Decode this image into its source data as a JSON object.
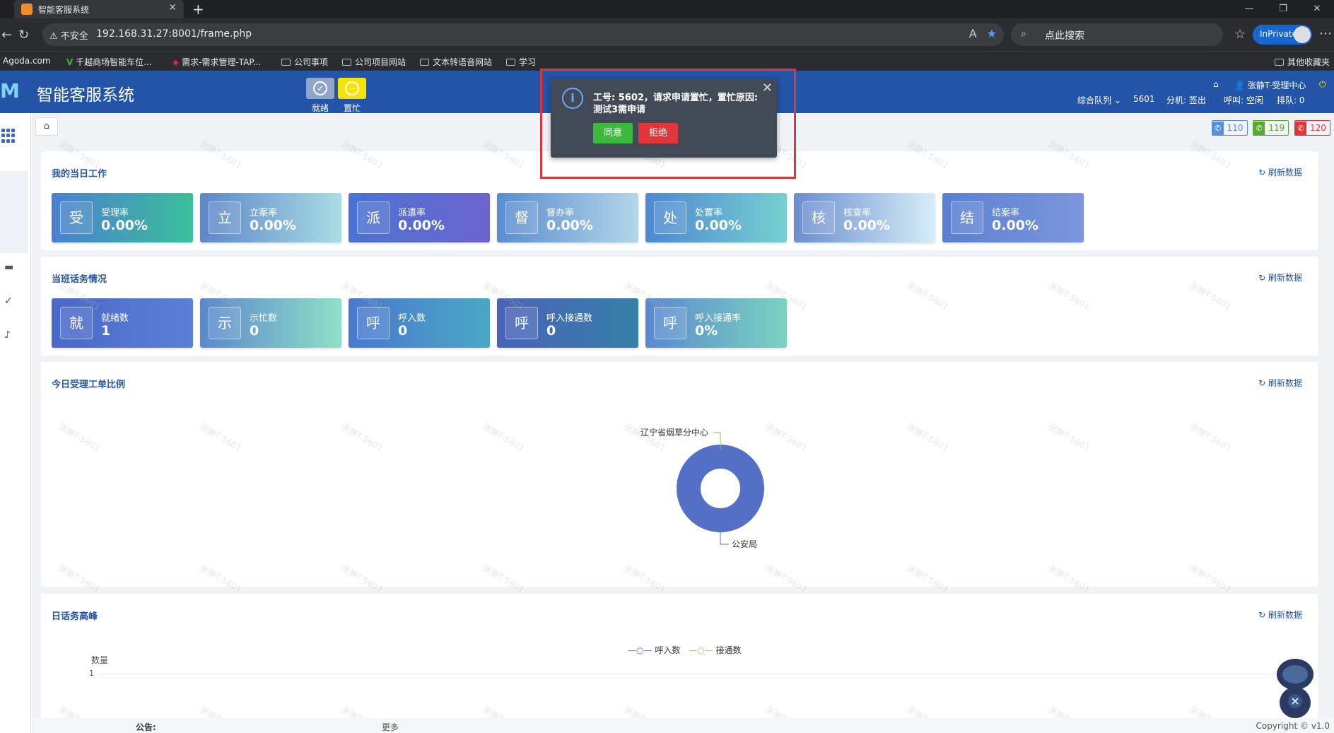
{
  "browser": {
    "tab_title": "智能客服系统",
    "new_tab": "+",
    "url_warning": "不安全",
    "url": "192.168.31.27:8001/frame.php",
    "search_placeholder": "点此搜索",
    "inprivate": "InPrivate",
    "bookmarks": [
      "Agoda.com",
      "千越商场智能车位...",
      "需求-需求管理-TAP...",
      "公司事项",
      "公司项目网站",
      "文本转语音网站",
      "学习"
    ],
    "other_bookmarks": "其他收藏夹"
  },
  "app": {
    "logo": "M",
    "title": "智能客服系统",
    "status_ready": "就绪",
    "status_busy": "置忙",
    "user": "张静T-受理中心",
    "queue": "综合队列",
    "agent_no": "5601",
    "ext_label": "分机: 签出",
    "call_label": "呼叫: 空闲",
    "rank_label": "排队: 0"
  },
  "hotlines": [
    "110",
    "119",
    "120"
  ],
  "popup": {
    "message": "工号: 5602，请求申请置忙，置忙原因: 测试3需申请",
    "agree": "同意",
    "reject": "拒绝"
  },
  "panels": {
    "refresh": "刷新数据",
    "daily_work": {
      "title": "我的当日工作",
      "cards": [
        {
          "icon": "受",
          "label": "受理率",
          "value": "0.00%"
        },
        {
          "icon": "立",
          "label": "立案率",
          "value": "0.00%"
        },
        {
          "icon": "派",
          "label": "派遣率",
          "value": "0.00%"
        },
        {
          "icon": "督",
          "label": "督办率",
          "value": "0.00%"
        },
        {
          "icon": "处",
          "label": "处置率",
          "value": "0.00%"
        },
        {
          "icon": "核",
          "label": "核查率",
          "value": "0.00%"
        },
        {
          "icon": "结",
          "label": "结案率",
          "value": "0.00%"
        }
      ]
    },
    "shift_calls": {
      "title": "当班话务情况",
      "cards": [
        {
          "icon": "就",
          "label": "就绪数",
          "value": "1"
        },
        {
          "icon": "示",
          "label": "示忙数",
          "value": "0"
        },
        {
          "icon": "呼",
          "label": "呼入数",
          "value": "0"
        },
        {
          "icon": "呼",
          "label": "呼入接通数",
          "value": "0"
        },
        {
          "icon": "呼",
          "label": "呼入接通率",
          "value": "0%"
        }
      ]
    },
    "ratio": {
      "title": "今日受理工单比例",
      "label_top": "辽宁省烟草分中心",
      "label_bottom": "公安局"
    },
    "peak": {
      "title": "日话务高峰",
      "ylabel": "数量",
      "ytick": "1",
      "legend_in": "呼入数",
      "legend_conn": "接通数"
    }
  },
  "chart_data": [
    {
      "type": "pie",
      "title": "今日受理工单比例",
      "categories": [
        "辽宁省烟草分中心",
        "公安局"
      ],
      "values": [
        0,
        1
      ]
    },
    {
      "type": "line",
      "title": "日话务高峰",
      "ylabel": "数量",
      "series": [
        {
          "name": "呼入数",
          "values": []
        },
        {
          "name": "接通数",
          "values": []
        }
      ]
    }
  ],
  "watermark": "张静T-5601",
  "footer": {
    "notice_label": "公告:",
    "more": "更多",
    "copyright": "Copyright © v1.0"
  },
  "colors": {
    "header": "#2354a8",
    "accent": "#3a68c8",
    "agree": "#3db93d",
    "reject": "#e0353b"
  }
}
